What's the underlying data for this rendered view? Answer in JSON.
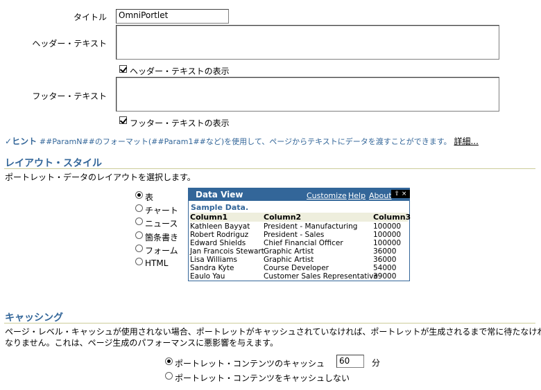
{
  "form": {
    "title_label": "タイトル",
    "title_value": "OmniPortlet",
    "header_label": "ヘッダー・テキスト",
    "header_value": "",
    "show_header_label": "ヘッダー・テキストの表示",
    "footer_label": "フッター・テキスト",
    "footer_value": "",
    "show_footer_label": "フッター・テキストの表示"
  },
  "hint": {
    "prefix": "ヒント",
    "text": "##ParamN##のフォーマット(##Param1##など)を使用して、ページからテキストにデータを渡すことができます。",
    "link": "詳細..."
  },
  "layout": {
    "title": "レイアウト・スタイル",
    "description": "ポートレット・データのレイアウトを選択します。",
    "options": [
      "表",
      "チャート",
      "ニュース",
      "箇条書き",
      "フォーム",
      "HTML"
    ],
    "selected": "表"
  },
  "preview": {
    "title": "Data View",
    "links": [
      "Customize",
      "Help",
      "About"
    ],
    "sample_title": "Sample Data.",
    "columns": [
      "Column1",
      "Column2",
      "Column3"
    ],
    "rows": [
      [
        "Kathleen Bayyat",
        "President - Manufacturing",
        "100000"
      ],
      [
        "Robert Rodriguz",
        "President - Sales",
        "100000"
      ],
      [
        "Edward Shields",
        "Chief Financial Officer",
        "100000"
      ],
      [
        "Jan Francois Stewart",
        "Graphic Artist",
        "36000"
      ],
      [
        "Lisa Williams",
        "Graphic Artist",
        "36000"
      ],
      [
        "Sandra Kyte",
        "Course Developer",
        "54000"
      ],
      [
        "Eaulo Yau",
        "Customer Sales Representative",
        "39000"
      ]
    ]
  },
  "caching": {
    "title": "キャッシング",
    "description_line1": "ページ・レベル・キャッシュが使用されない場合、ポートレットがキャッシュされていなければ、ポートレットが生成されるまで常に待たなければ",
    "description_line2": "なりません。これは、ページ生成のパフォーマンスに悪影響を与えます。",
    "option_cache": "ポートレット・コンテンツのキャッシュ",
    "cache_minutes": "60",
    "minutes_unit": "分",
    "option_no_cache": "ポートレット・コンテンツをキャッシュしない",
    "selected": "cache"
  },
  "colors": {
    "accent": "#336699",
    "rule": "#cccc99"
  }
}
